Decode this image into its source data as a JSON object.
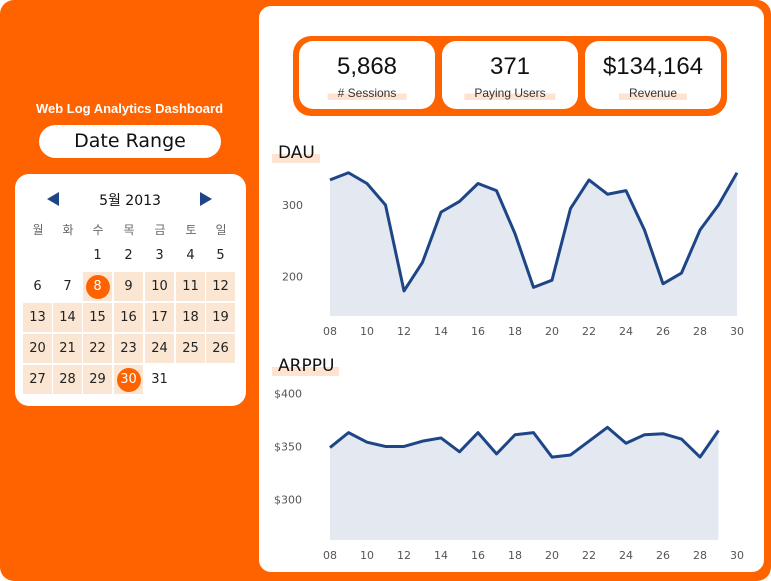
{
  "sidebar": {
    "title": "Web Log Analytics Dashboard",
    "date_range_label": "Date Range",
    "calendar": {
      "month_label": "5월 2013",
      "weekdays": [
        "월",
        "화",
        "수",
        "목",
        "금",
        "토",
        "일"
      ],
      "weeks": [
        [
          null,
          null,
          1,
          2,
          3,
          4,
          5
        ],
        [
          6,
          7,
          8,
          9,
          10,
          11,
          12
        ],
        [
          13,
          14,
          15,
          16,
          17,
          18,
          19
        ],
        [
          20,
          21,
          22,
          23,
          24,
          25,
          26
        ],
        [
          27,
          28,
          29,
          30,
          31,
          null,
          null
        ]
      ],
      "range_start": 8,
      "range_end": 30,
      "prev_icon": "triangle-left-icon",
      "next_icon": "triangle-right-icon"
    }
  },
  "kpis": [
    {
      "value": "5,868",
      "label": "# Sessions"
    },
    {
      "value": "371",
      "label": "Paying Users"
    },
    {
      "value": "$134,164",
      "label": "Revenue"
    }
  ],
  "colors": {
    "accent": "#fe6300",
    "line": "#1e4687",
    "area": "#e3e8f1",
    "range_bg": "#fbe6d4"
  },
  "chart_data": [
    {
      "type": "area",
      "title": "DAU",
      "x": [
        8,
        9,
        10,
        11,
        12,
        13,
        14,
        15,
        16,
        17,
        18,
        19,
        20,
        21,
        22,
        23,
        24,
        25,
        26,
        27,
        28,
        29,
        30
      ],
      "x_tick_labels": [
        "08",
        "10",
        "12",
        "14",
        "16",
        "18",
        "20",
        "22",
        "24",
        "26",
        "28",
        "30"
      ],
      "series": [
        {
          "values": [
            335,
            345,
            330,
            300,
            180,
            220,
            290,
            305,
            330,
            320,
            260,
            185,
            195,
            295,
            335,
            315,
            320,
            265,
            190,
            205,
            265,
            300,
            345
          ]
        }
      ],
      "y_ticks": [
        200,
        300
      ],
      "ylim": [
        145,
        360
      ]
    },
    {
      "type": "area",
      "title": "ARPPU",
      "x": [
        8,
        9,
        10,
        11,
        12,
        13,
        14,
        15,
        16,
        17,
        18,
        19,
        20,
        21,
        22,
        23,
        24,
        25,
        26,
        27,
        28,
        29,
        30
      ],
      "x_tick_labels": [
        "08",
        "10",
        "12",
        "14",
        "16",
        "18",
        "20",
        "22",
        "24",
        "26",
        "28",
        "30"
      ],
      "series": [
        {
          "values": [
            349,
            363,
            354,
            350,
            350,
            355,
            358,
            345,
            363,
            343,
            361,
            363,
            340,
            342,
            355,
            368,
            353,
            361,
            362,
            357,
            340,
            365,
            null
          ]
        }
      ],
      "y_ticks": [
        "$400",
        "$350",
        "$300"
      ],
      "y_tick_values": [
        400,
        350,
        300
      ],
      "ylim": [
        262,
        405
      ]
    }
  ]
}
